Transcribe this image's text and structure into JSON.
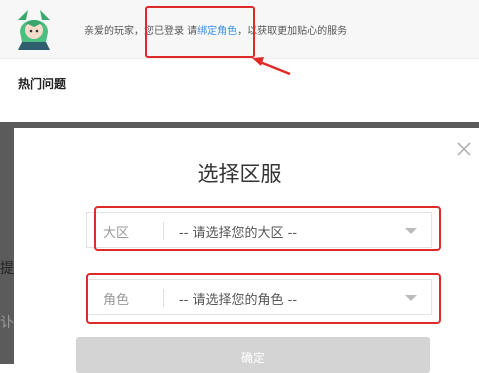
{
  "notice": {
    "prefix": "亲爱的玩家，您已登录 请",
    "link": "绑定角色",
    "suffix": "，以获取更加贴心的服务"
  },
  "section": {
    "title": "热门问题"
  },
  "bg_hints": {
    "a": "提",
    "b": "讣"
  },
  "modal": {
    "title": "选择区服",
    "region": {
      "label": "大区",
      "placeholder": "-- 请选择您的大区 --"
    },
    "role": {
      "label": "角色",
      "placeholder": "-- 请选择您的角色 --"
    },
    "confirm": "确定"
  },
  "colors": {
    "highlight": "#e02a2a",
    "link": "#3a8ee6"
  }
}
